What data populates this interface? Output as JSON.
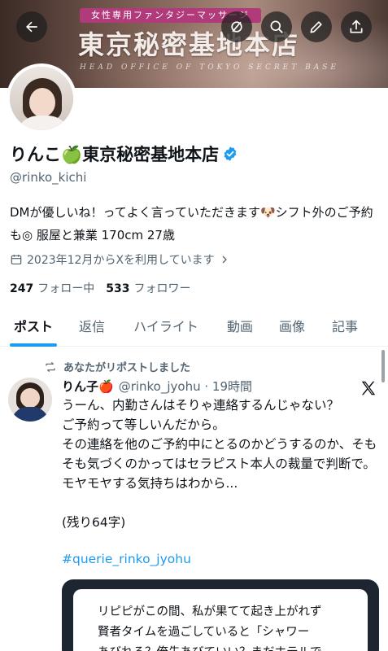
{
  "banner": {
    "subtitle": "女性専用ファンタジーマッサージ",
    "title": "東京秘密基地本店",
    "english": "HEAD OFFICE OF TOKYO SECRET BASE"
  },
  "profile": {
    "name": "りんこ🍏東京秘密基地本店",
    "handle": "@rinko_kichi",
    "bio": "DMが優しいね！ってよく言っていただきます🐶シフト外のご予約も◎ 服屋と兼業 170cm 27歳",
    "joined": "2023年12月からXを利用しています",
    "following_count": "247",
    "following_label": "フォロー中",
    "followers_count": "533",
    "followers_label": "フォロワー"
  },
  "tabs": [
    "ポスト",
    "返信",
    "ハイライト",
    "動画",
    "画像",
    "記事"
  ],
  "post": {
    "repost_text": "あなたがリポストしました",
    "author_name": "りん子🍎",
    "author_meta": "@rinko_jyohu · 19時間",
    "body": "うーん、内勤さんはそりゃ連絡するんじゃない？\nご予約って等しいんだから。\nその連絡を他のご予約中にとるのかどうするのか、そもそも気づくのかってはセラピスト本人の裁量で判断で。\nモヤモヤする気持ちはわから...\n\n(残り64字)",
    "hashtag": "#querie_rinko_jyohu",
    "card_text": "リピピがこの間、私が果てて起き上がれず\n賢者タイムを過ごしていると「シャワー\nあびれる？俺先あびていい？まだホテルで"
  },
  "colors": {
    "accent": "#1d9bf0",
    "muted": "#536471",
    "text": "#0f1419"
  },
  "icons": [
    "back-arrow-icon",
    "grok-icon",
    "search-icon",
    "edit-icon",
    "share-icon",
    "verified-badge-icon",
    "calendar-icon",
    "chevron-right-icon",
    "repost-icon",
    "x-logo-icon"
  ]
}
